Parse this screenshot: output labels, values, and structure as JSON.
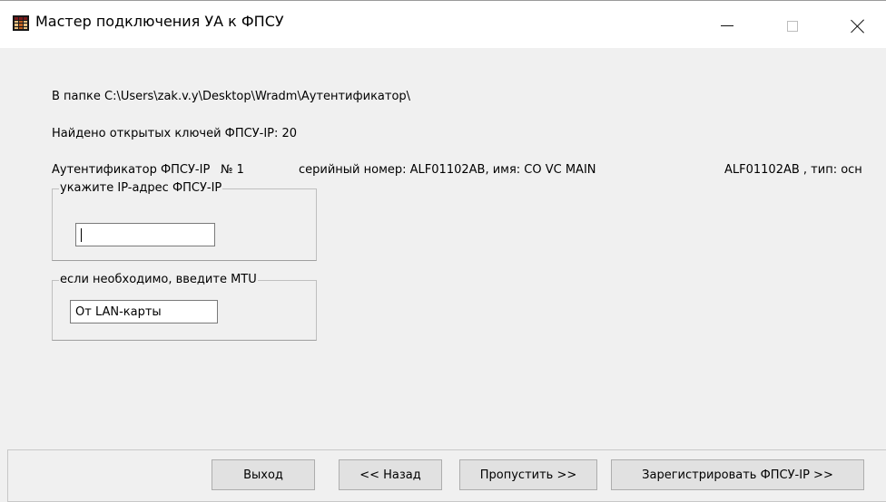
{
  "window": {
    "title": "Мастер подключения УА к ФПСУ",
    "controls": {
      "minimize": "minimize",
      "maximize": "maximize",
      "close": "close"
    }
  },
  "info": {
    "folder": "В папке C:\\Users\\zak.v.y\\Desktop\\Wradm\\Аутентификатор\\",
    "found": "Найдено открытых ключей ФПСУ-IP: 20",
    "auth_label": "Аутентификатор ФПСУ-IP",
    "auth_number": "№ 1",
    "serial": "серийный номер: ALF01102AB, имя: CO VC MAIN",
    "type": "ALF01102AB , тип: осн"
  },
  "ip_group": {
    "legend": "укажите IP-адрес ФПСУ-IP",
    "value": ""
  },
  "mtu_group": {
    "legend": "если необходимо, введите MTU",
    "value": "От LAN-карты"
  },
  "buttons": {
    "exit": "Выход",
    "back": "<< Назад",
    "skip": "Пропустить >>",
    "register": "Зарегистрировать ФПСУ-IP >>"
  },
  "icons": {
    "app": "app-grid-icon",
    "minimize": "minimize-icon",
    "maximize": "maximize-icon",
    "close": "close-icon"
  }
}
